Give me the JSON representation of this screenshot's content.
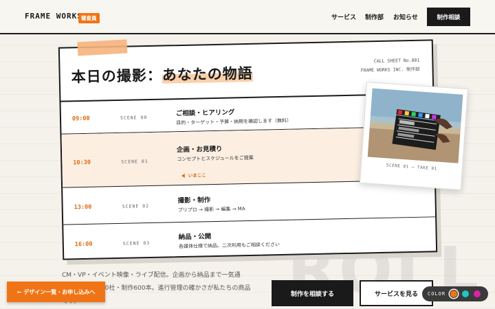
{
  "header": {
    "brand": "FRAME WORKS",
    "badge": "審査員",
    "nav": [
      "サービス",
      "制作部",
      "お知らせ"
    ],
    "cta": "制作相談"
  },
  "card": {
    "title_prefix": "本日の撮影：",
    "title_highlight": "あなたの物語",
    "callsheet_line1": "CALL SHEET No.001",
    "callsheet_line2": "FRAME WORKS INC. 制作部",
    "now_label": "いまここ",
    "rows": [
      {
        "time": "09:00",
        "scene": "SCENE 00",
        "title": "ご相談・ヒアリング",
        "desc": "目的・ターゲット・予算・納期を確認します（無料）"
      },
      {
        "time": "10:30",
        "scene": "SCENE 01",
        "title": "企画・お見積り",
        "desc": "コンセプトとスケジュールをご提案"
      },
      {
        "time": "13:00",
        "scene": "SCENE 02",
        "title": "撮影・制作",
        "desc": "プリプロ → 撮影 → 編集 → MA"
      },
      {
        "time": "16:00",
        "scene": "SCENE 03",
        "title": "納品・公開",
        "desc": "各媒体仕様で納品。二次利用もご相談ください"
      }
    ]
  },
  "polaroid": {
    "caption": "SCENE 01 — TAKE 01"
  },
  "watermark": "ROLL",
  "intro": {
    "line1": "CM・VP・イベント映像・ライブ配信。企画から納品まで一気通",
    "line2": "貫。取引社数 30社・制作600本。進行管理の確かさが私たちの商品",
    "line3": "です。"
  },
  "buttons": {
    "floating": "← デザイン一覧・お申し込みへ",
    "primary": "制作を相談する",
    "secondary": "サービスを見る"
  },
  "color_picker": {
    "label": "COLOR",
    "swatches": [
      "#f07416",
      "#1fc7c0",
      "#e01fa8"
    ],
    "selected": "#f07416"
  }
}
